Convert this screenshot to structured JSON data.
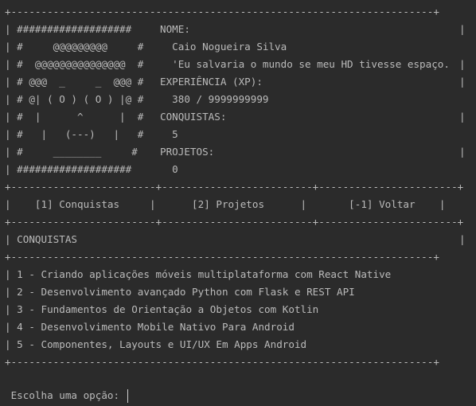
{
  "profile": {
    "border_top": "+----------------------------------------------------------------------+",
    "art": [
      "| ###################  ",
      "| #     @@@@@@@@@     #  ",
      "| #  @@@@@@@@@@@@@@@  #  ",
      "| # @@@  _     _  @@@ #  ",
      "| # @| ( O ) ( O ) |@ #  ",
      "| #  |      ^      |  #  ",
      "| #   |   (---)   |   #  ",
      "| #     ________     #  ",
      "| ###################  "
    ],
    "fields": [
      "NOME:",
      "  Caio Nogueira Silva",
      "  'Eu salvaria o mundo se meu HD tivesse espaço.",
      "EXPERIÊNCIA (XP):",
      "  380 / 9999999999",
      "CONQUISTAS:",
      "  5",
      "PROJETOS:",
      "  0"
    ],
    "right_edges": [
      "|",
      "",
      "|",
      "|",
      "",
      "|",
      "",
      "|",
      ""
    ]
  },
  "menu": {
    "border_top": "+------------------------+-------------------------+-----------------------+",
    "line": "|    [1] Conquistas     |      [2] Projetos      |       [-1] Voltar    |",
    "border_bottom": "+------------------------+-------------------------+-----------------------+"
  },
  "achievements": {
    "header": "| CONQUISTAS",
    "header_right": "|",
    "divider": "+----------------------------------------------------------------------+",
    "items": [
      "| 1 - Criando aplicações móveis multiplataforma com React Native",
      "| 2 - Desenvolvimento avançado Python com Flask e REST API",
      "| 3 - Fundamentos de Orientação a Objetos com Kotlin",
      "| 4 - Desenvolvimento Mobile Nativo Para Android",
      "| 5 - Componentes, Layouts e UI/UX Em Apps Android"
    ],
    "border_bottom": "+----------------------------------------------------------------------+"
  },
  "prompt": {
    "text": " Escolha uma opção: "
  },
  "colors": {
    "background": "#2b2b2b",
    "text": "#bbbbbb"
  }
}
